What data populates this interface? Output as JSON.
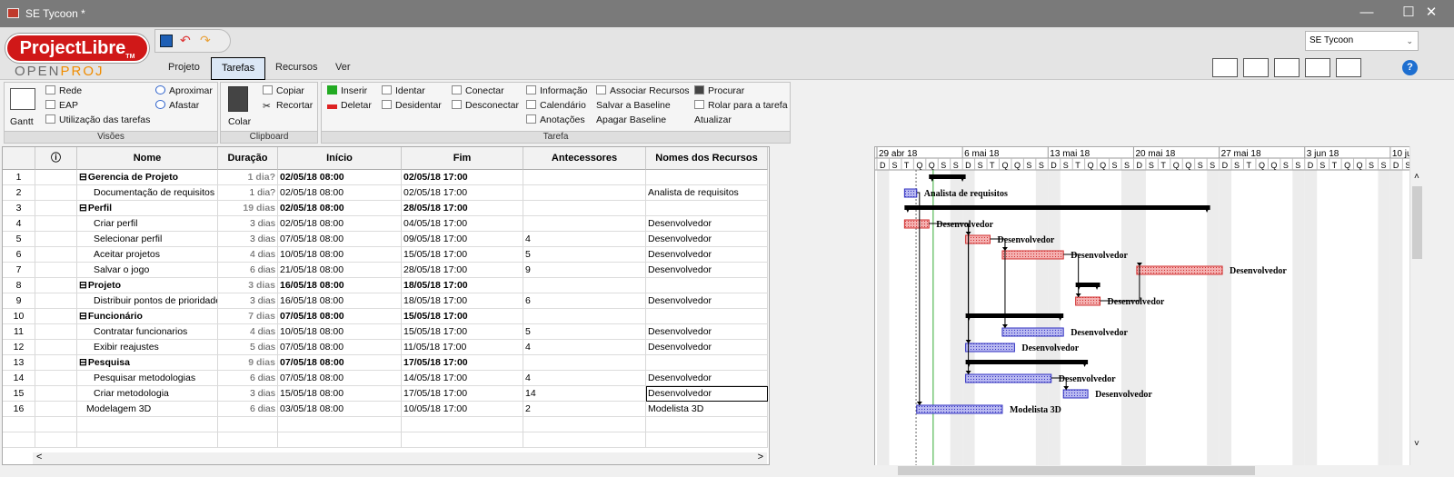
{
  "window": {
    "title": "SE Tycoon *",
    "minimize": "—",
    "maximize": "☐",
    "close": "✕"
  },
  "logo": {
    "brand": "ProjectLibre",
    "tm": "TM",
    "sub_a": "OPEN",
    "sub_b": "PROJ"
  },
  "tabs": [
    {
      "label": "Projeto"
    },
    {
      "label": "Tarefas"
    },
    {
      "label": "Recursos"
    },
    {
      "label": "Ver"
    }
  ],
  "project_selector": {
    "value": "SE Tycoon",
    "arrow": "⌄"
  },
  "help_label": "?",
  "ribbon": {
    "visoes": {
      "label": "Visões",
      "gantt": "Gantt",
      "rede": "Rede",
      "eap": "EAP",
      "utilizacao": "Utilização das tarefas",
      "aproximar": "Aproximar",
      "afastar": "Afastar"
    },
    "clipboard": {
      "label": "Clipboard",
      "colar": "Colar",
      "copiar": "Copiar",
      "recortar": "Recortar"
    },
    "tarefa": {
      "label": "Tarefa",
      "inserir": "Inserir",
      "deletar": "Deletar",
      "identar": "Identar",
      "desidentar": "Desidentar",
      "conectar": "Conectar",
      "desconectar": "Desconectar",
      "informacao": "Informação",
      "calendario": "Calendário",
      "anotacoes": "Anotações",
      "associar": "Associar Recursos",
      "salvar_baseline": "Salvar a Baseline",
      "apagar_baseline": "Apagar Baseline",
      "procurar": "Procurar",
      "rolar": "Rolar para a tarefa",
      "atualizar": "Atualizar"
    }
  },
  "table": {
    "headers": {
      "info": "ⓘ",
      "nome": "Nome",
      "duracao": "Duração",
      "inicio": "Início",
      "fim": "Fim",
      "antecessores": "Antecessores",
      "recursos": "Nomes dos Recursos"
    },
    "rows": [
      {
        "id": "1",
        "nome": "Gerencia de Projeto",
        "duracao": "1 dia?",
        "inicio": "02/05/18 08:00",
        "fim": "02/05/18 17:00",
        "ante": "",
        "rec": ""
      },
      {
        "id": "2",
        "nome": "Documentação de requisitos",
        "duracao": "1 dia?",
        "inicio": "02/05/18 08:00",
        "fim": "02/05/18 17:00",
        "ante": "",
        "rec": "Analista de requisitos"
      },
      {
        "id": "3",
        "nome": "Perfil",
        "duracao": "19 dias",
        "inicio": "02/05/18 08:00",
        "fim": "28/05/18 17:00",
        "ante": "",
        "rec": ""
      },
      {
        "id": "4",
        "nome": "Criar perfil",
        "duracao": "3 dias",
        "inicio": "02/05/18 08:00",
        "fim": "04/05/18 17:00",
        "ante": "",
        "rec": "Desenvolvedor"
      },
      {
        "id": "5",
        "nome": "Selecionar perfil",
        "duracao": "3 dias",
        "inicio": "07/05/18 08:00",
        "fim": "09/05/18 17:00",
        "ante": "4",
        "rec": "Desenvolvedor"
      },
      {
        "id": "6",
        "nome": "Aceitar projetos",
        "duracao": "4 dias",
        "inicio": "10/05/18 08:00",
        "fim": "15/05/18 17:00",
        "ante": "5",
        "rec": "Desenvolvedor"
      },
      {
        "id": "7",
        "nome": "Salvar o jogo",
        "duracao": "6 dias",
        "inicio": "21/05/18 08:00",
        "fim": "28/05/18 17:00",
        "ante": "9",
        "rec": "Desenvolvedor"
      },
      {
        "id": "8",
        "nome": "Projeto",
        "duracao": "3 dias",
        "inicio": "16/05/18 08:00",
        "fim": "18/05/18 17:00",
        "ante": "",
        "rec": ""
      },
      {
        "id": "9",
        "nome": "Distribuir pontos de prioridade",
        "duracao": "3 dias",
        "inicio": "16/05/18 08:00",
        "fim": "18/05/18 17:00",
        "ante": "6",
        "rec": "Desenvolvedor"
      },
      {
        "id": "10",
        "nome": "Funcionário",
        "duracao": "7 dias",
        "inicio": "07/05/18 08:00",
        "fim": "15/05/18 17:00",
        "ante": "",
        "rec": ""
      },
      {
        "id": "11",
        "nome": "Contratar funcionarios",
        "duracao": "4 dias",
        "inicio": "10/05/18 08:00",
        "fim": "15/05/18 17:00",
        "ante": "5",
        "rec": "Desenvolvedor"
      },
      {
        "id": "12",
        "nome": "Exibir reajustes",
        "duracao": "5 dias",
        "inicio": "07/05/18 08:00",
        "fim": "11/05/18 17:00",
        "ante": "4",
        "rec": "Desenvolvedor"
      },
      {
        "id": "13",
        "nome": "Pesquisa",
        "duracao": "9 dias",
        "inicio": "07/05/18 08:00",
        "fim": "17/05/18 17:00",
        "ante": "",
        "rec": ""
      },
      {
        "id": "14",
        "nome": "Pesquisar metodologias",
        "duracao": "6 dias",
        "inicio": "07/05/18 08:00",
        "fim": "14/05/18 17:00",
        "ante": "4",
        "rec": "Desenvolvedor"
      },
      {
        "id": "15",
        "nome": "Criar metodologia",
        "duracao": "3 dias",
        "inicio": "15/05/18 08:00",
        "fim": "17/05/18 17:00",
        "ante": "14",
        "rec": "Desenvolvedor"
      },
      {
        "id": "16",
        "nome": "Modelagem 3D",
        "duracao": "6 dias",
        "inicio": "03/05/18 08:00",
        "fim": "10/05/18 17:00",
        "ante": "2",
        "rec": "Modelista 3D"
      }
    ]
  },
  "gantt": {
    "weeks": [
      "29 abr 18",
      "6 mai 18",
      "13 mai 18",
      "20 mai 18",
      "27 mai 18",
      "3 jun 18",
      "10 ju"
    ],
    "day_letters": [
      "D",
      "S",
      "T",
      "Q",
      "Q",
      "S",
      "S"
    ],
    "bars": [
      {
        "row": 1,
        "type": "summary",
        "start": 5,
        "end": 8,
        "label": ""
      },
      {
        "row": 2,
        "type": "task",
        "color": "blue",
        "start": 3,
        "end": 4,
        "label": "Analista de requisitos"
      },
      {
        "row": 3,
        "type": "summary",
        "start": 3,
        "end": 28,
        "label": ""
      },
      {
        "row": 4,
        "type": "task",
        "color": "red",
        "start": 3,
        "end": 5,
        "label": "Desenvolvedor"
      },
      {
        "row": 5,
        "type": "task",
        "color": "red",
        "start": 8,
        "end": 10,
        "label": "Desenvolvedor"
      },
      {
        "row": 6,
        "type": "task",
        "color": "red",
        "start": 11,
        "end": 16,
        "label": "Desenvolvedor"
      },
      {
        "row": 7,
        "type": "task",
        "color": "red",
        "start": 22,
        "end": 29,
        "label": "Desenvolvedor"
      },
      {
        "row": 8,
        "type": "summary",
        "start": 17,
        "end": 19,
        "label": ""
      },
      {
        "row": 9,
        "type": "task",
        "color": "red",
        "start": 17,
        "end": 19,
        "label": "Desenvolvedor"
      },
      {
        "row": 10,
        "type": "summary",
        "start": 8,
        "end": 16,
        "label": ""
      },
      {
        "row": 11,
        "type": "task",
        "color": "blue",
        "start": 11,
        "end": 16,
        "label": "Desenvolvedor"
      },
      {
        "row": 12,
        "type": "task",
        "color": "blue",
        "start": 8,
        "end": 12,
        "label": "Desenvolvedor"
      },
      {
        "row": 13,
        "type": "summary",
        "start": 8,
        "end": 18,
        "label": ""
      },
      {
        "row": 14,
        "type": "task",
        "color": "blue",
        "start": 8,
        "end": 15,
        "label": "Desenvolvedor"
      },
      {
        "row": 15,
        "type": "task",
        "color": "blue",
        "start": 16,
        "end": 18,
        "label": "Desenvolvedor"
      },
      {
        "row": 16,
        "type": "task",
        "color": "blue",
        "start": 4,
        "end": 11,
        "label": "Modelista 3D"
      }
    ]
  },
  "scroll": {
    "left": "<",
    "right": ">",
    "up": "˄",
    "down": "˅"
  },
  "colors": {
    "accent": "#2b5797",
    "critical": "#e05050",
    "task": "#5b5bd6",
    "summary": "#000000"
  }
}
